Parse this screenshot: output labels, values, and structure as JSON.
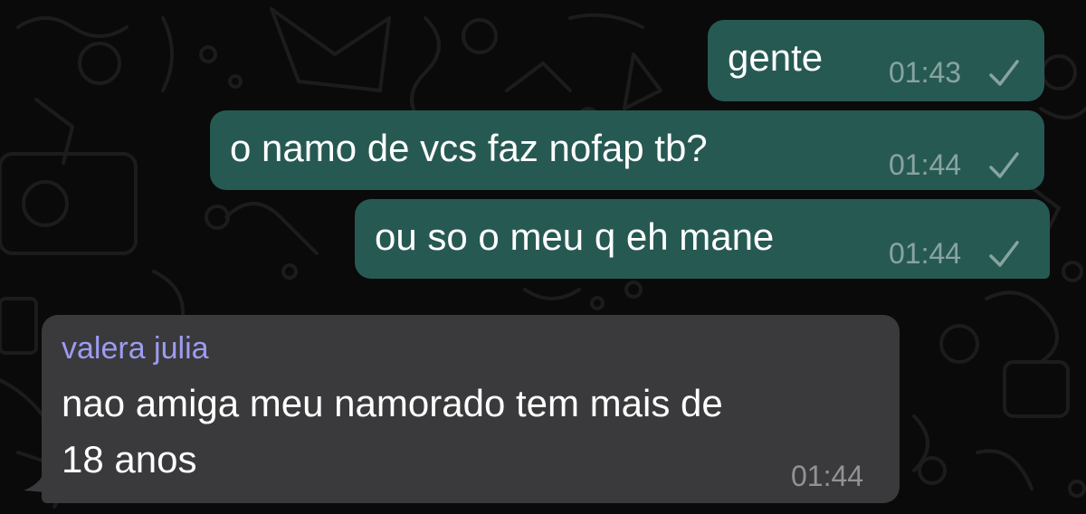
{
  "conversation": {
    "messages": [
      {
        "direction": "outgoing",
        "text": "gente",
        "time": "01:43",
        "status_icon": "check-icon"
      },
      {
        "direction": "outgoing",
        "text": "o namo de vcs faz nofap tb?",
        "time": "01:44",
        "status_icon": "check-icon"
      },
      {
        "direction": "outgoing",
        "text": "ou so o meu q eh mane",
        "time": "01:44",
        "status_icon": "check-icon"
      },
      {
        "direction": "incoming",
        "sender": "valera julia",
        "text_line1": "nao amiga meu namorado tem mais de",
        "text_line2": "18 anos",
        "time": "01:44"
      }
    ]
  },
  "colors": {
    "background": "#0a0a0a",
    "outgoing_bubble": "#275953",
    "incoming_bubble": "#3a3a3c",
    "sender_name": "#9c9cf2",
    "text": "#ffffff"
  }
}
